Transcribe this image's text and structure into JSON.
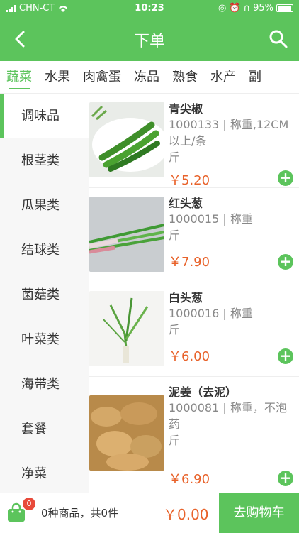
{
  "status": {
    "carrier": "CHN-CT",
    "time": "10:23",
    "battery": "95%"
  },
  "header": {
    "title": "下单"
  },
  "tabs": [
    "蔬菜",
    "水果",
    "肉禽蛋",
    "冻品",
    "熟食",
    "水产",
    "副"
  ],
  "sidebar": [
    "调味品",
    "根茎类",
    "瓜果类",
    "结球类",
    "菌菇类",
    "叶菜类",
    "海带类",
    "套餐",
    "净菜"
  ],
  "products": [
    {
      "name": "青尖椒",
      "desc": "1000133 | 称重,12CM以上/条",
      "unit": "斤",
      "price": "￥5.20"
    },
    {
      "name": "红头葱",
      "desc": "1000015 | 称重",
      "unit": "斤",
      "price": "￥7.90"
    },
    {
      "name": "白头葱",
      "desc": "1000016 | 称重",
      "unit": "斤",
      "price": "￥6.00"
    },
    {
      "name": "泥姜（去泥）",
      "desc": "1000081 | 称重，不泡药",
      "unit": "斤",
      "price": "￥6.90"
    }
  ],
  "cart": {
    "badge": "0",
    "summary": "0种商品，共0件",
    "total": "￥0.00",
    "checkout": "去购物车"
  },
  "colors": {
    "primary": "#5cc45c",
    "price": "#e8622a",
    "badge": "#e84a3a"
  }
}
